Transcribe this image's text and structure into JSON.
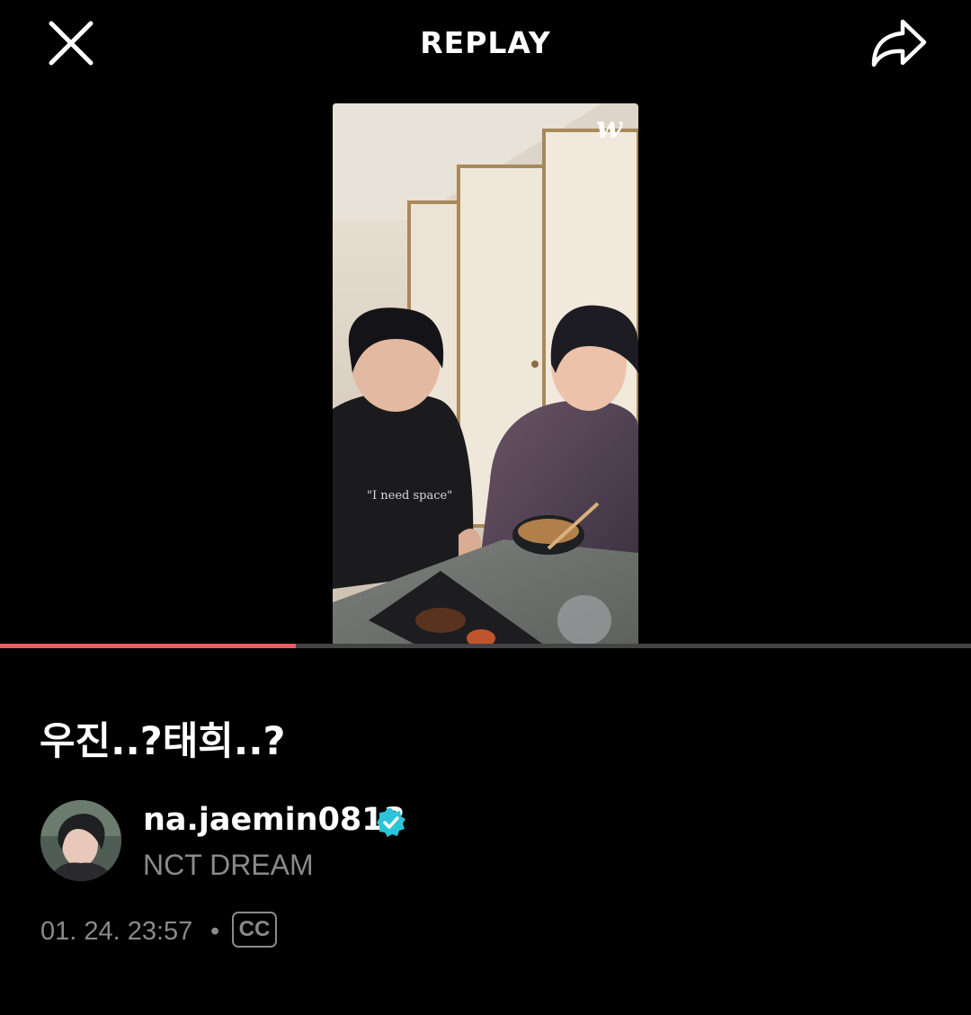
{
  "header": {
    "title": "REPLAY",
    "close_icon": "close-icon",
    "share_icon": "share-icon"
  },
  "player": {
    "watermark": "w",
    "progress": 0.305,
    "progress_color": "#ec5b62",
    "track_color": "#444444"
  },
  "video": {
    "title": "우진..?태희..?"
  },
  "channel": {
    "name": "na.jaemin0813",
    "subtitle": "NCT DREAM",
    "verified_icon": "verified-badge-icon",
    "verified_color": "#2bc4d8"
  },
  "meta": {
    "date": "01. 24. 23:57",
    "separator": "•",
    "cc_label": "CC"
  }
}
